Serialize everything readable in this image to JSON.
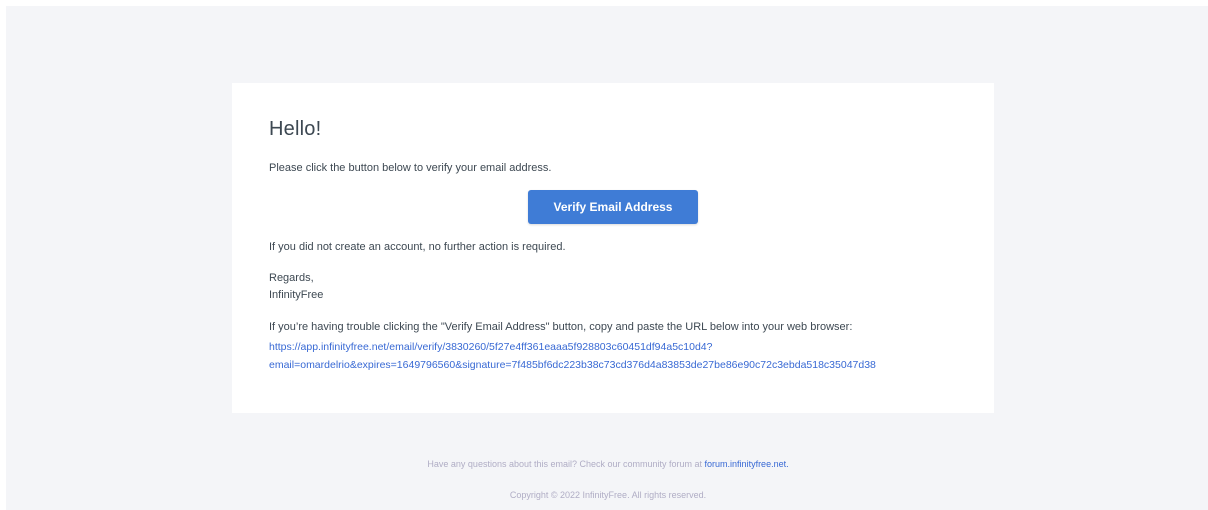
{
  "email": {
    "greeting": "Hello!",
    "intro": "Please click the button below to verify your email address.",
    "button_label": "Verify Email Address",
    "no_action": "If you did not create an account, no further action is required.",
    "regards": "Regards,",
    "sender": "InfinityFree",
    "trouble_text": "If you’re having trouble clicking the \"Verify Email Address\" button, copy and paste the URL below into your web browser:",
    "verify_url_line1": "https://app.infinityfree.net/email/verify/3830260/5f27e4ff361eaaa5f928803c60451df94a5c10d4?",
    "verify_url_line2": "email=omardelrio&expires=1649796560&signature=7f485bf6dc223b38c73cd376d4a83853de27be86e90c72c3ebda518c35047d38"
  },
  "footer": {
    "question_prefix": "Have any questions about this email? Check our community forum at ",
    "forum_link": "forum.infinityfree.net.",
    "copyright": "Copyright © 2022 InfinityFree. All rights reserved."
  },
  "colors": {
    "background": "#f4f5f8",
    "card": "#ffffff",
    "button": "#3f7cd6",
    "link": "#3869d4",
    "text": "#3d4852",
    "footer_text": "#b0adc5"
  }
}
